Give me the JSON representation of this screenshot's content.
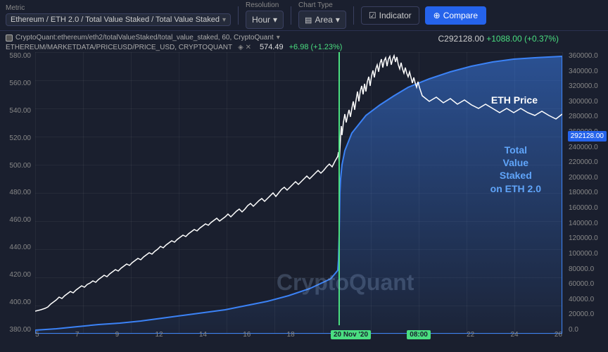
{
  "topbar": {
    "metric_label": "Metric",
    "metric_value": "Ethereum / ETH 2.0 / Total Value Staked / Total Value Staked",
    "resolution_label": "Resolution",
    "resolution_value": "Hour",
    "chart_type_label": "Chart Type",
    "chart_type_value": "Area",
    "chart_type_icon": "▤",
    "indicator_label": "Indicator",
    "compare_label": "Compare",
    "compare_icon": "+"
  },
  "chart": {
    "series1_path": "CryptoQuant:ethereum/eth2/totalValueStaked/total_value_staked, 60, CryptoQuant",
    "series1_icon": "□",
    "series2_path": "ETHEREUM/MARKETDATA/PRICEUSD/PRICE_USD, CRYPTOQUANT",
    "series2_settings": "◈ ✕",
    "series2_value": "574.49",
    "series2_change": "+6.98 (+1.23%)",
    "top_price": "C292128.00",
    "top_price_change": "+1088.00 (+0.37%)",
    "watermark": "CryptoQuant",
    "eth_price_label": "ETH Price",
    "tvs_label": "Total\nValue\nStaked\non ETH 2.0",
    "price_badge_value": "292128.00",
    "price_badge_y_pct": 28,
    "vertical_line_x_pct": 57.5,
    "y_axis_left": [
      "580.00",
      "560.00",
      "540.00",
      "520.00",
      "500.00",
      "480.00",
      "460.00",
      "440.00",
      "420.00",
      "400.00",
      "380.00"
    ],
    "y_axis_right": [
      "360000.0",
      "340000.0",
      "320000.0",
      "300000.0",
      "280000.0",
      "260000.0",
      "240000.0",
      "220000.0",
      "200000.0",
      "180000.0",
      "160000.0",
      "140000.0",
      "120000.0",
      "100000.0",
      "80000.0",
      "60000.0",
      "40000.0",
      "20000.0",
      "0.0"
    ],
    "x_axis_labels": [
      "5",
      "7",
      "9",
      "12",
      "14",
      "16",
      "18",
      "20 Nov '20",
      "08:00",
      "22",
      "24",
      "26"
    ],
    "x_axis_highlight": "20 Nov '20",
    "x_axis_highlight2": "08:00"
  }
}
